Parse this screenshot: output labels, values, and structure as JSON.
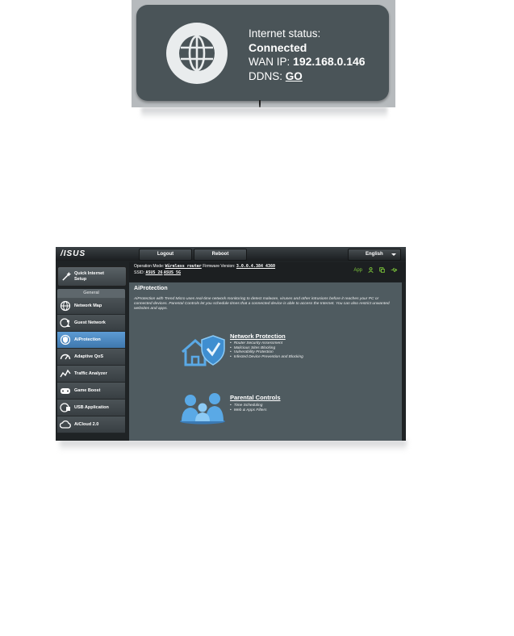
{
  "internet_status": {
    "label": "Internet status:",
    "value": "Connected",
    "wan_ip_label": "WAN IP:",
    "wan_ip": "192.168.0.146",
    "ddns_label": "DDNS:",
    "ddns_link": "GO"
  },
  "router_ui": {
    "brand": "/ISUS",
    "buttons": {
      "logout": "Logout",
      "reboot": "Reboot"
    },
    "language": "English",
    "info": {
      "mode_label": "Operation Mode:",
      "mode_value": "Wireless router",
      "firmware_label": "Firmware Version:",
      "firmware_value": "3.0.0.4.384_4360",
      "ssid_label": "SSID:",
      "ssid_1": "ASUS_26",
      "ssid_2": "ASUS_5G",
      "app_label": "App"
    },
    "sidebar": {
      "qis_line1": "Quick Internet",
      "qis_line2": "Setup",
      "section_header": "General",
      "items": [
        {
          "label": "Network Map",
          "icon": "network-map-icon"
        },
        {
          "label": "Guest Network",
          "icon": "guest-network-icon"
        },
        {
          "label": "AiProtection",
          "icon": "aiprotection-icon",
          "active": true
        },
        {
          "label": "Adaptive QoS",
          "icon": "adaptive-qos-icon"
        },
        {
          "label": "Traffic Analyzer",
          "icon": "traffic-analyzer-icon"
        },
        {
          "label": "Game Boost",
          "icon": "game-boost-icon"
        },
        {
          "label": "USB Application",
          "icon": "usb-application-icon"
        },
        {
          "label": "AiCloud 2.0",
          "icon": "aicloud-icon"
        }
      ]
    },
    "content": {
      "title": "AiProtection",
      "description": "AiProtection with Trend Micro uses real-time network monitoring to detect malware, viruses and other intrusions before it reaches your PC or connected devices. Parental Controls let you schedule times that a connected device is able to access the Internet. You can also restrict unwanted websites and apps.",
      "network_protection": {
        "title": "Network Protection",
        "items": [
          "Router Security Assessment",
          "Malicious Sites Blocking",
          "Vulnerability Protection",
          "Infected Device Prevention and Blocking"
        ]
      },
      "parental_controls": {
        "title": "Parental Controls",
        "items": [
          "Time Scheduling",
          "Web & Apps Filters"
        ]
      }
    },
    "colors": {
      "accent_blue": "#4a8fcc",
      "status_green": "#7cc63a",
      "panel": "#4f5b60"
    }
  }
}
